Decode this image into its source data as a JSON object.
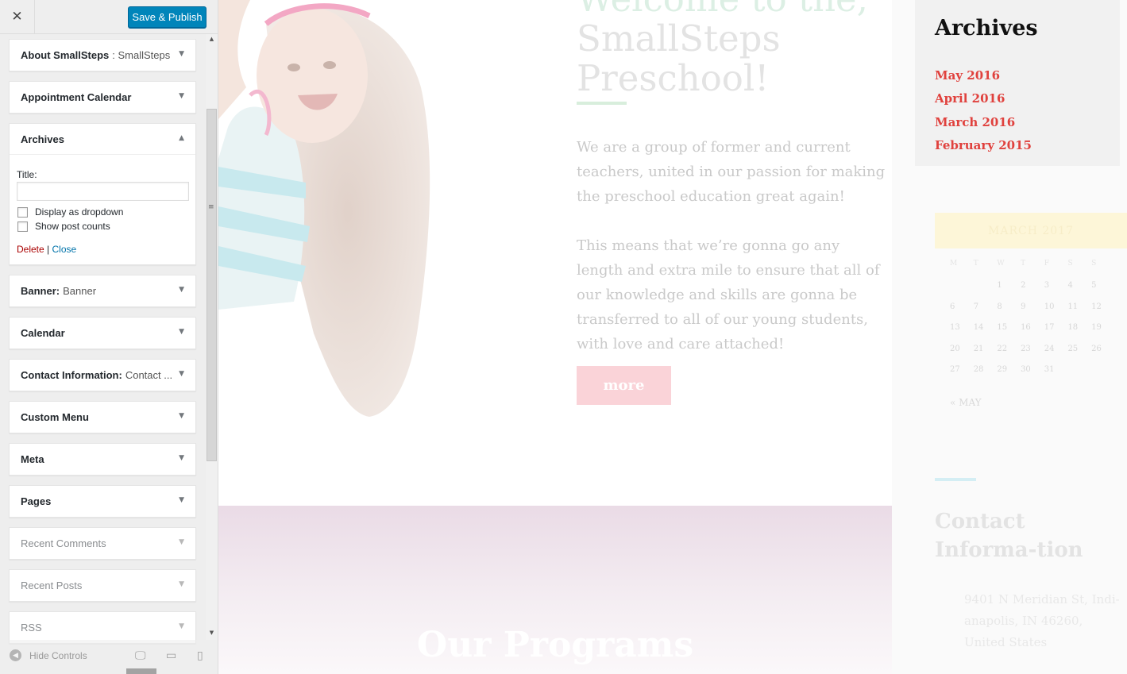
{
  "topbar": {
    "close_glyph": "✕",
    "publish_label": "Save & Publish"
  },
  "widgets": [
    {
      "title": "About SmallSteps",
      "sub": ": SmallSteps"
    },
    {
      "title": "Appointment Calendar",
      "sub": ""
    },
    {
      "title": "Archives",
      "sub": "",
      "open": true
    },
    {
      "title": "Banner:",
      "sub": "Banner"
    },
    {
      "title": "Calendar",
      "sub": ""
    },
    {
      "title": "Contact Information:",
      "sub": "Contact ..."
    },
    {
      "title": "Custom Menu",
      "sub": ""
    },
    {
      "title": "Meta",
      "sub": ""
    },
    {
      "title": "Pages",
      "sub": ""
    },
    {
      "title": "Recent Comments",
      "sub": ""
    },
    {
      "title": "Recent Posts",
      "sub": ""
    },
    {
      "title": "RSS",
      "sub": ""
    }
  ],
  "archives_form": {
    "title_label": "Title:",
    "title_value": "",
    "dropdown_label": "Display as dropdown",
    "post_counts_label": "Show post counts",
    "delete_label": "Delete",
    "separator": "|",
    "close_label": "Close"
  },
  "footer": {
    "hide_label": "Hide Controls",
    "hide_icon": "◀",
    "desktop_icon": "🖵",
    "tablet_icon": "▭",
    "mobile_icon": "▯"
  },
  "preview": {
    "welcome_line1": "Welcome to the,",
    "welcome_line2": "SmallSteps",
    "welcome_line3": "Preschool!",
    "intro_p1": "We are a group of former and current teachers, united in our passion for making the preschool education great again!",
    "intro_p2": "This means that we’re gonna go any length and extra mile to ensure that all of our knowledge and skills are gonna be transferred to all of our young students, with love and care attached!",
    "more_label": "more",
    "programs_title": "Our Programs"
  },
  "sidebar_widgets": {
    "archives_title": "Archives",
    "archive_links": [
      "May 2016",
      "April 2016",
      "March 2016",
      "February 2015"
    ],
    "calendar": {
      "month": "MARCH 2017",
      "days_of_week": [
        "M",
        "T",
        "W",
        "T",
        "F",
        "S",
        "S"
      ],
      "first_weekday_index": 2,
      "days_in_month": 31,
      "prev_label": "« MAY"
    },
    "contact_title": "Contact Informa-tion",
    "contact_address": "9401 N Meridian St, Indi-anapolis, IN 46260, United States"
  },
  "colors": {
    "accent_blue": "#0085ba",
    "archive_link": "#e0413d",
    "more_button": "#fad3d8"
  }
}
